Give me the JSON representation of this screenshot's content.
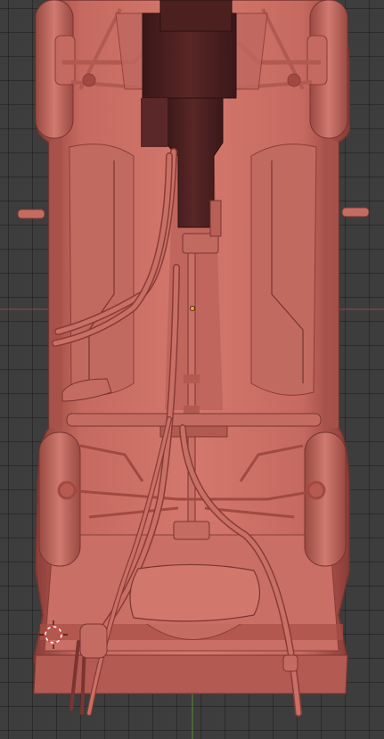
{
  "viewport": {
    "background_color": "#3d3d3d",
    "grid_color": "#2e2e2e",
    "x_axis_color": "#a0404e",
    "y_axis_color": "#5a8a2a"
  },
  "model": {
    "view": "bottom-orthographic",
    "material_color": "#c96b62",
    "shadow_color": "#7a3530",
    "engine_color": "#4a2020",
    "origin_color": "#f0a020"
  },
  "cursor": {
    "icon": "3d-cursor-icon"
  }
}
